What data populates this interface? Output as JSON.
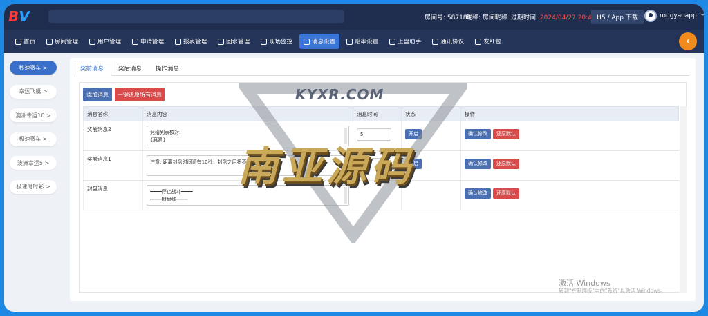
{
  "logo": {
    "b": "B",
    "v": "V"
  },
  "header": {
    "room_id": "房间号: 587188",
    "nickname": "昵称: 房间昵称",
    "expire_label": "过期时间: ",
    "expire_value": "2024/04/27 20:49:11",
    "h5_download": "H5 / App 下载",
    "username": "rongyaoapp",
    "user_chevron": "﹀"
  },
  "nav": [
    {
      "label": "首页"
    },
    {
      "label": "房间管理"
    },
    {
      "label": "用户管理"
    },
    {
      "label": "申请管理"
    },
    {
      "label": "报表管理"
    },
    {
      "label": "回水管理"
    },
    {
      "label": "现场监控"
    },
    {
      "label": "消息设置"
    },
    {
      "label": "赔率设置"
    },
    {
      "label": "上盘助手"
    },
    {
      "label": "通讯协议"
    },
    {
      "label": "发红包"
    }
  ],
  "collapse_glyph": "‹",
  "sidebar": [
    {
      "label": "秒速赛车 >"
    },
    {
      "label": "幸运飞艇 >"
    },
    {
      "label": "澳洲幸运10 >"
    },
    {
      "label": "极速赛车 >"
    },
    {
      "label": "澳洲幸运5 >"
    },
    {
      "label": "极速时时彩 >"
    }
  ],
  "tabs": [
    {
      "label": "奖前消息"
    },
    {
      "label": "奖后消息"
    },
    {
      "label": "操作消息"
    }
  ],
  "buttons": {
    "add": "添加消息",
    "reset_all": "一键还原所有消息"
  },
  "table": {
    "headers": [
      "消息名称",
      "消息内容",
      "消息时间",
      "状态",
      "操作"
    ],
    "rows": [
      {
        "name": "奖前消息2",
        "content1": "竞猜列表核对:",
        "content2": "{竞猜}",
        "time": "5",
        "status": "开启",
        "confirm": "确认修改",
        "restore": "还原默认"
      },
      {
        "name": "奖前消息1",
        "content1": "注意: 距离封盘时间还有10秒，封盘之后将不能再竞注!",
        "content2": "",
        "time": "18",
        "status": "开启",
        "confirm": "确认修改",
        "restore": "还原默认"
      },
      {
        "name": "封盘消息",
        "content1": "━━━━停止战斗━━━━",
        "content2": "━━━━封盘线━━━━",
        "time": "",
        "status": "",
        "confirm": "确认修改",
        "restore": "还原默认"
      }
    ]
  },
  "watermark": {
    "small": "KYXR.COM",
    "big": "南亚源码"
  },
  "windows": {
    "line1": "激活 Windows",
    "line2": "转到\"控制面板\"中的\"系统\"以激活 Windows。"
  }
}
